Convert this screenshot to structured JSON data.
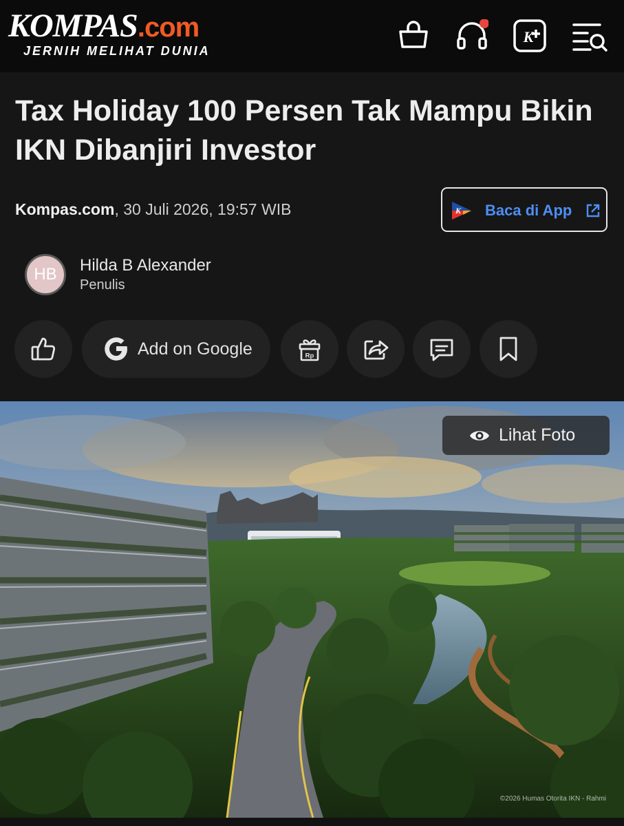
{
  "header": {
    "brand_main": "KOMPAS",
    "brand_suffix": ".com",
    "tagline": "JERNIH MELIHAT DUNIA",
    "icons": [
      "shopping-bag-icon",
      "headphones-icon",
      "kplus-icon",
      "menu-search-icon"
    ],
    "notification_dot_color": "#e8453c"
  },
  "article": {
    "title": "Tax Holiday 100 Persen Tak Mampu Bikin IKN Dibanjiri Investor",
    "source": "Kompas.com",
    "datetime": ", 30 Juli 2026, 19:57 WIB",
    "app_button_label": "Baca di App",
    "author": {
      "initials": "HB",
      "name": "Hilda B Alexander",
      "role": "Penulis"
    },
    "actions": {
      "google_label": "Add on Google",
      "icons": [
        "thumbs-up-icon",
        "google-icon",
        "gift-rp-icon",
        "share-icon",
        "comment-icon",
        "bookmark-icon"
      ]
    }
  },
  "photo": {
    "button_label": "Lihat Foto",
    "credit": "©2026 Humas Otorita IKN - Rahmi"
  },
  "colors": {
    "accent_orange": "#f15a24",
    "link_blue": "#4d8ef5",
    "background": "#161616",
    "header_bg": "#0b0b0b"
  }
}
